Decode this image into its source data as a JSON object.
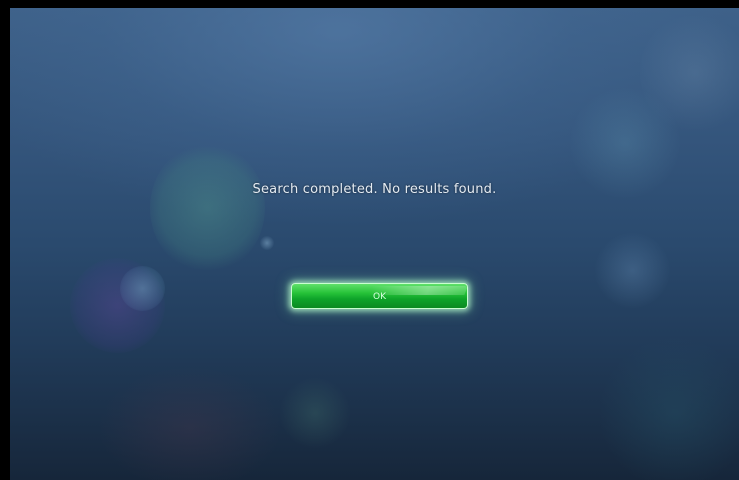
{
  "dialog": {
    "message": "Search completed. No results found.",
    "ok_label": "OK"
  },
  "colors": {
    "background_top": "#3e6189",
    "background_bottom": "#16263a",
    "button_green": "#1fb634",
    "text": "#e4ebf2"
  }
}
